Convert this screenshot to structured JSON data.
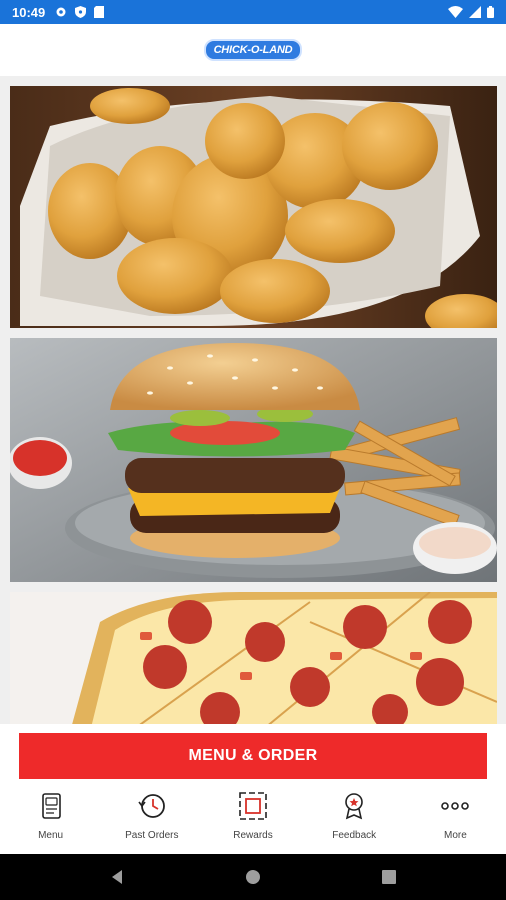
{
  "status_bar": {
    "time": "10:49",
    "icons": [
      "gear-icon",
      "shield-icon",
      "sim-card-icon"
    ],
    "right_icons": [
      "wifi-icon",
      "signal-icon",
      "battery-icon"
    ],
    "color": "#1a73d9"
  },
  "header": {
    "logo_text": "CHICK-O-LAND"
  },
  "feed": {
    "tiles": [
      "chicken-nuggets",
      "cheeseburger-with-fries",
      "pepperoni-pizza"
    ]
  },
  "cta": {
    "label": "MENU & ORDER",
    "color": "#ee2a2a"
  },
  "bottom_nav": {
    "items": [
      {
        "label": "Menu",
        "icon": "menu-icon"
      },
      {
        "label": "Past Orders",
        "icon": "history-icon"
      },
      {
        "label": "Rewards",
        "icon": "rewards-icon"
      },
      {
        "label": "Feedback",
        "icon": "feedback-icon"
      },
      {
        "label": "More",
        "icon": "more-icon"
      }
    ]
  },
  "system_nav": {
    "buttons": [
      "back-icon",
      "home-icon",
      "recents-icon"
    ]
  }
}
